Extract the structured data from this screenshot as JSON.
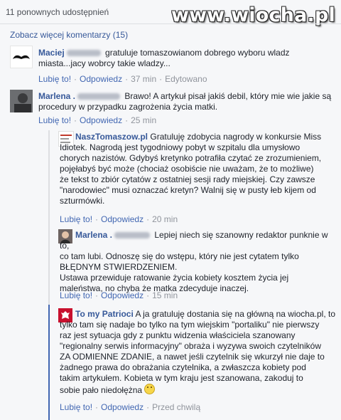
{
  "watermark": "www.wiocha.pl",
  "shares_text": "11 ponownych udostępnień",
  "more_comments": "Zobacz więcej komentarzy (15)",
  "actions": {
    "like": "Lubię to!",
    "reply": "Odpowiedz",
    "sep": "·"
  },
  "comments": [
    {
      "author": "Maciej",
      "text_lines": [
        " gratuluje tomaszowianom dobrego wyboru wladz",
        "miasta...jacy wobrcy takie wladzy..."
      ],
      "time": "37 min",
      "edited": "Edytowano"
    },
    {
      "author": "Marlena .",
      "text_lines": [
        " Brawo! A artykuł pisał jakiś debil, który mie wie jakie są",
        "procedury w przypadku zagrożenia życia matki."
      ],
      "time": "25 min"
    },
    {
      "author": "NaszTomaszow.pl",
      "text_lines": [
        " Gratuluję zdobycia nagrody w konkursie Miss",
        "Idiotek. Nagrodą jest tygodniowy pobyt w szpitalu dla umysłowo",
        "chorych nazistów. Gdybyś kretynko potrafiła czytać ze zrozumieniem,",
        "pojęłabyś być może (chociaż osobiście nie uważam, że to możliwe)",
        "że tekst to zbiór cytatów z ostatniej sesji rady miejskiej. Czy zawsze",
        "\"narodowiec\" musi oznaczać kretyn? Walnij się w pusty łeb kijem od",
        "szturmówki."
      ],
      "time": "20 min"
    },
    {
      "author": "Marlena .",
      "text_lines": [
        " Lepiej niech się szanowny redaktor punknie w to,",
        "co tam lubi. Odnoszę się do wstępu, który nie jest cytatem tylko",
        "BŁĘDNYM STWIERDZENIEM.",
        "Ustawa przewiduje ratowanie życia kobiety kosztem życia jej",
        "maleństwa, no chyba że matka zdecyduje inaczej."
      ],
      "time": "15 min"
    },
    {
      "author": "To my Patrioci",
      "text_lines": [
        " A ja gratuluję dostania się na główną na wiocha.pl, to",
        "tylko tam się nadaje bo tylko na tym wiejskim \"portaliku\" nie pierwszy",
        "raz jest sytuacja gdy z punktu widzenia właściciela szanowany",
        "\"regionalny serwis informacyjny\" obraża i wyzywa swoich czytelników",
        "ZA ODMIENNE ZDANIE, a nawet jeśli czytelnik się wkurzył nie daje to",
        "żadnego prawa do obrażania czytelnika, a zwłaszcza kobiety pod",
        "takim artykułem. Kobieta w tym kraju jest szanowana, zakoduj to",
        "sobie pało niedołężna"
      ],
      "time": "Przed chwilą"
    }
  ],
  "colors": {
    "link": "#365899",
    "action_link": "#4267b2",
    "muted": "#90949c",
    "background": "#f6f7f9"
  }
}
